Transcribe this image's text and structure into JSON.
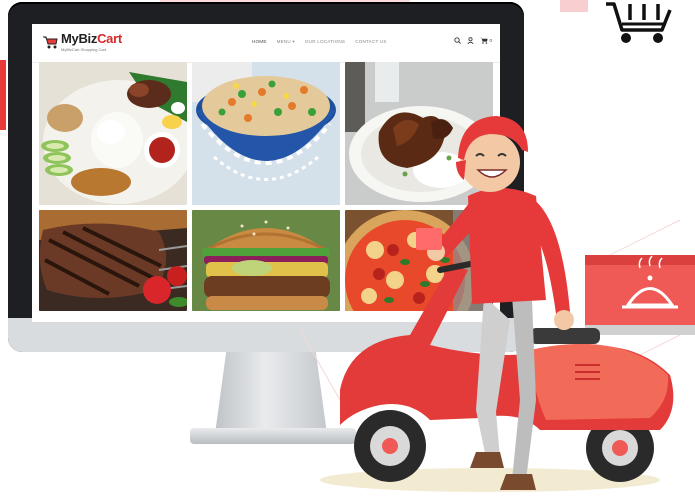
{
  "site": {
    "logo_name_prefix": "MyBiz",
    "logo_name_suffix": "Cart",
    "logo_tagline": "MyBizCart Shopping Cart"
  },
  "nav": {
    "items": [
      {
        "label": "HOME",
        "active": true
      },
      {
        "label": "MENU ▾",
        "active": false
      },
      {
        "label": "OUR LOCATIONS",
        "active": false
      },
      {
        "label": "CONTACT US",
        "active": false
      }
    ],
    "cart_count": "0"
  },
  "menu_grid": [
    {
      "item": "nasi-lemak"
    },
    {
      "item": "fried-rice"
    },
    {
      "item": "chicken-rice"
    },
    {
      "item": "grilled-steak"
    },
    {
      "item": "burger"
    },
    {
      "item": "pizza"
    }
  ],
  "colors": {
    "brand_red": "#e8393b",
    "monitor_bezel": "#1d1f22",
    "scooter_red": "#e33b3a",
    "box_red": "#ef5a57"
  },
  "icons": {
    "search": "search-icon",
    "user": "user-icon",
    "cart": "cart-icon",
    "corner_cart": "shopping-cart-outline-icon",
    "cloche": "food-cloche-icon"
  }
}
